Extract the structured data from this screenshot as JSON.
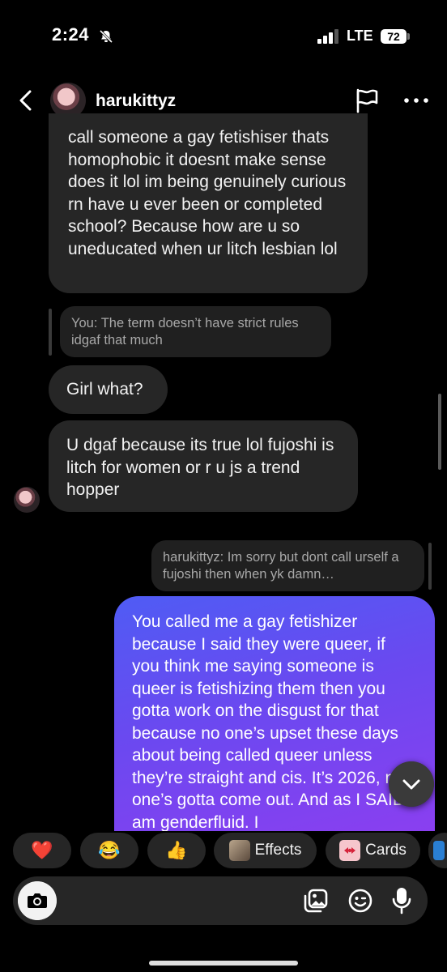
{
  "status_bar": {
    "time": "2:24",
    "network": "LTE",
    "battery": "72"
  },
  "header": {
    "username": "harukittyz"
  },
  "messages": {
    "incoming_1": "call someone a gay fetishiser thats homophobic it doesnt make sense does it lol im being genuinely curious rn have u ever been or completed school? Because how are u so uneducated when ur litch lesbian lol",
    "reply_quote_left": "You: The term doesn’t have strict rules idgaf that much",
    "incoming_2": "Girl what?",
    "incoming_3": "U dgaf because its true lol fujoshi is litch for women or r u js a trend hopper",
    "reply_quote_right": "harukittyz: Im sorry but dont call urself a fujoshi then when yk damn…",
    "outgoing_1": "You called me a gay fetishizer because I said they were queer, if you think me saying someone is queer is fetishizing them then you gotta work on the disgust for that because no one’s upset these days about being called queer unless they’re straight and cis. It’s 2026, no one’s gotta come out. And as I SAID I am genderfluid. I"
  },
  "quick_reactions": {
    "heart": "❤️",
    "laugh": "😂",
    "thumbs_up": "👍",
    "effects_label": "Effects",
    "cards_label": "Cards"
  },
  "colors": {
    "background": "#000000",
    "incoming_bubble": "#262626",
    "outgoing_gradient_start": "#4f5cf4",
    "outgoing_gradient_end": "#8a3ff0"
  },
  "icons": [
    "back-icon",
    "flag-icon",
    "more-icon",
    "camera-icon",
    "gallery-icon",
    "sticker-icon",
    "mic-icon",
    "chevron-down-icon",
    "bell-off-icon",
    "signal-icon"
  ]
}
